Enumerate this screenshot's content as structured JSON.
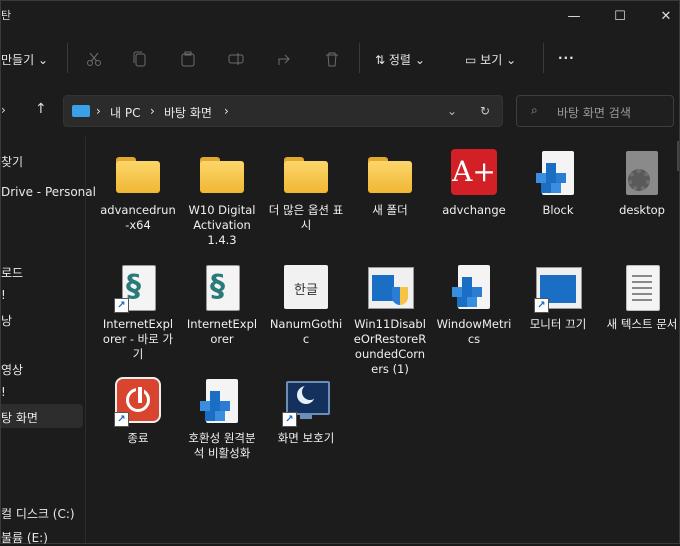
{
  "window": {
    "title_fragment": "탄",
    "minimize": "—",
    "maximize": "☐",
    "close": "✕"
  },
  "toolbar": {
    "new_label": "만들기",
    "sort_label": "정렬",
    "view_label": "보기",
    "more_label": "···"
  },
  "address": {
    "crumbs": [
      "내 PC",
      "바탕 화면"
    ],
    "search_placeholder": "바탕 화면 검색"
  },
  "nav": {
    "items": [
      "찾기",
      "Drive - Personal",
      "로드",
      "!",
      "낭",
      "영상",
      "!",
      "탕 화면",
      "컬 디스크 (C:)",
      "불륨 (E:)"
    ]
  },
  "items": [
    {
      "label": "advancedrun-x64",
      "icon": "folder-icon"
    },
    {
      "label": "W10 Digital Activation 1.4.3",
      "icon": "folder-icon"
    },
    {
      "label": "더 많은 옵션 표시",
      "icon": "folder-icon"
    },
    {
      "label": "새 폴더",
      "icon": "folder-icon"
    },
    {
      "label": "advchange",
      "icon": "acrobat-icon"
    },
    {
      "label": "Block",
      "icon": "registry-icon"
    },
    {
      "label": "desktop",
      "icon": "settings-file-icon"
    },
    {
      "label": "InternetExplorer - 바로 가기",
      "icon": "script-shortcut-icon"
    },
    {
      "label": "InternetExplorer",
      "icon": "script-icon"
    },
    {
      "label": "NanumGothic",
      "icon": "font-file-icon",
      "glyph": "한글"
    },
    {
      "label": "Win11DisableOrRestoreRoundedCorners (1)",
      "icon": "app-shield-icon"
    },
    {
      "label": "WindowMetrics",
      "icon": "registry-icon"
    },
    {
      "label": "모니터 끄기",
      "icon": "monitor-window-shortcut-icon"
    },
    {
      "label": "새 텍스트 문서",
      "icon": "text-file-icon"
    },
    {
      "label": "종료",
      "icon": "power-shortcut-icon"
    },
    {
      "label": "호환성 원격분석 비활성화",
      "icon": "registry-icon"
    },
    {
      "label": "화면 보호기",
      "icon": "screensaver-shortcut-icon"
    }
  ],
  "colors": {
    "background": "#1c1c1c",
    "folder": "#f5c445",
    "accent_red": "#d32027",
    "registry_blue": "#1a6fc4"
  }
}
